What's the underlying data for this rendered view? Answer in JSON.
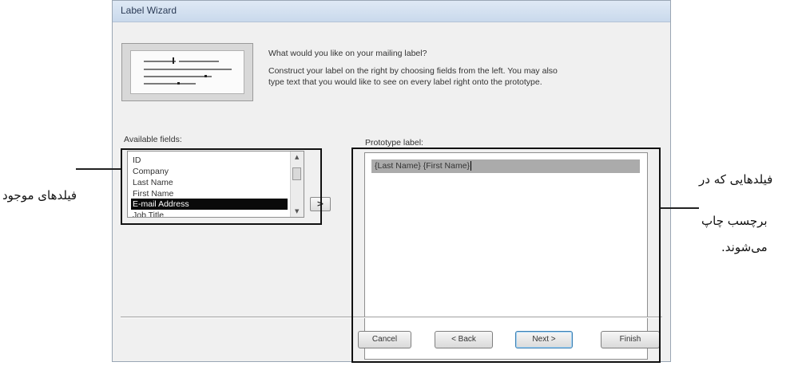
{
  "window": {
    "title": "Label Wizard"
  },
  "instructions": {
    "question": "What would you like on your mailing label?",
    "line1": "Construct your label on the right by choosing fields from the left. You may also",
    "line2": "type text that you would like to see on every label right onto the prototype."
  },
  "available_fields": {
    "label": "Available fields:",
    "items": [
      "ID",
      "Company",
      "Last Name",
      "First Name",
      "E-mail Address",
      "Job Title"
    ],
    "selected": "E-mail Address"
  },
  "add_button": {
    "label": ">"
  },
  "prototype": {
    "label": "Prototype label:",
    "line": "{Last Name} {First Name}"
  },
  "buttons": {
    "cancel": "Cancel",
    "back": "< Back",
    "next": "Next >",
    "finish": "Finish"
  },
  "annotations": {
    "left": "فیلدهای موجود",
    "right_line1": "فیلدهایی که در",
    "right_line2": "برچسب چاپ",
    "right_line3": "می‌شوند."
  }
}
